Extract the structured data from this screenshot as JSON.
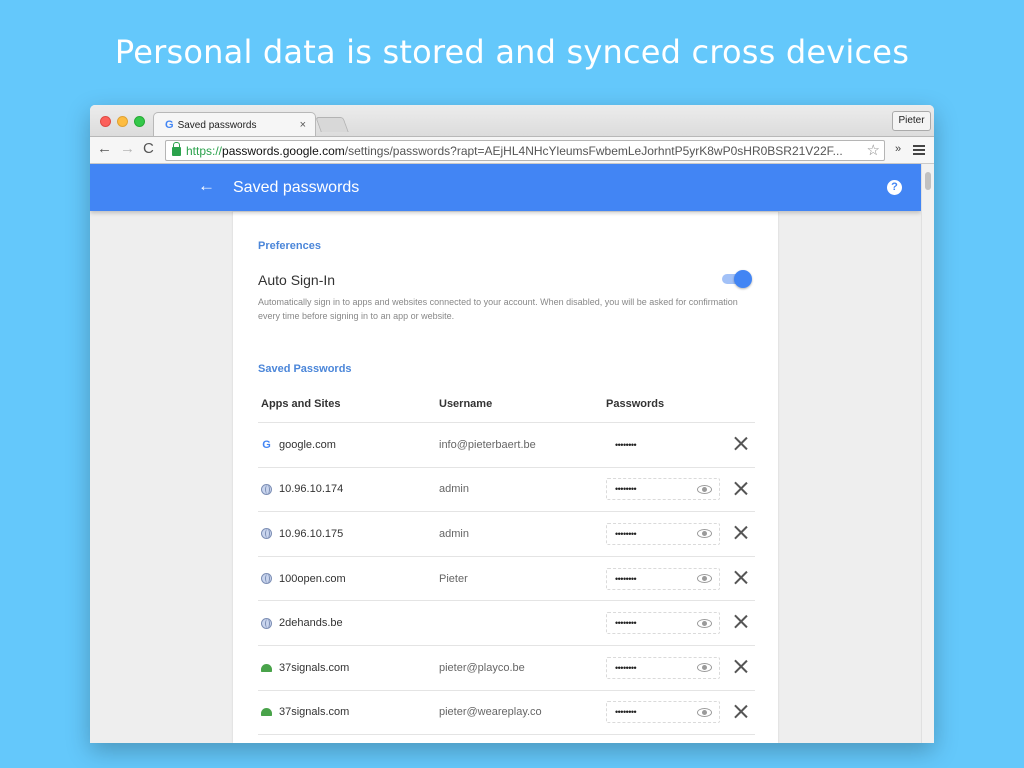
{
  "headline": "Personal data is stored and synced cross devices",
  "browser": {
    "tab_title": "Saved passwords",
    "tab_favicon": "G",
    "tab_close": "×",
    "profile_name": "Pieter",
    "url_scheme": "https://",
    "url_host": "passwords.google.com",
    "url_path": "/settings/passwords?rapt=AEjHL4NHcYleumsFwbemLeJorhntP5yrK8wP0sHR0BSR21V22F...",
    "nav_back": "←",
    "nav_forward": "→",
    "nav_reload": "C",
    "star": "☆",
    "ext_arrows": "»"
  },
  "appbar": {
    "back_arrow": "←",
    "title": "Saved passwords",
    "help": "?",
    "color": "#4285f4"
  },
  "preferences": {
    "section_label": "Preferences",
    "auto_signin_title": "Auto Sign-In",
    "auto_signin_enabled": true,
    "auto_signin_desc": "Automatically sign in to apps and websites connected to your account. When disabled, you will be asked for confirmation every time before signing in to an app or website."
  },
  "saved": {
    "section_label": "Saved Passwords",
    "headers": {
      "site": "Apps and Sites",
      "user": "Username",
      "pass": "Passwords"
    },
    "rows": [
      {
        "site": "google.com",
        "user": "info@pieterbaert.be",
        "pass": "••••••••",
        "icon": "google-icon"
      },
      {
        "site": "10.96.10.174",
        "user": "admin",
        "pass": "••••••••",
        "icon": "globe-icon"
      },
      {
        "site": "10.96.10.175",
        "user": "admin",
        "pass": "••••••••",
        "icon": "globe-icon"
      },
      {
        "site": "100open.com",
        "user": "Pieter",
        "pass": "••••••••",
        "icon": "globe-icon"
      },
      {
        "site": "2dehands.be",
        "user": "",
        "pass": "••••••••",
        "icon": "globe-icon"
      },
      {
        "site": "37signals.com",
        "user": "pieter@playco.be",
        "pass": "••••••••",
        "icon": "37signals-icon"
      },
      {
        "site": "37signals.com",
        "user": "pieter@weareplay.co",
        "pass": "••••••••",
        "icon": "37signals-icon"
      }
    ]
  }
}
